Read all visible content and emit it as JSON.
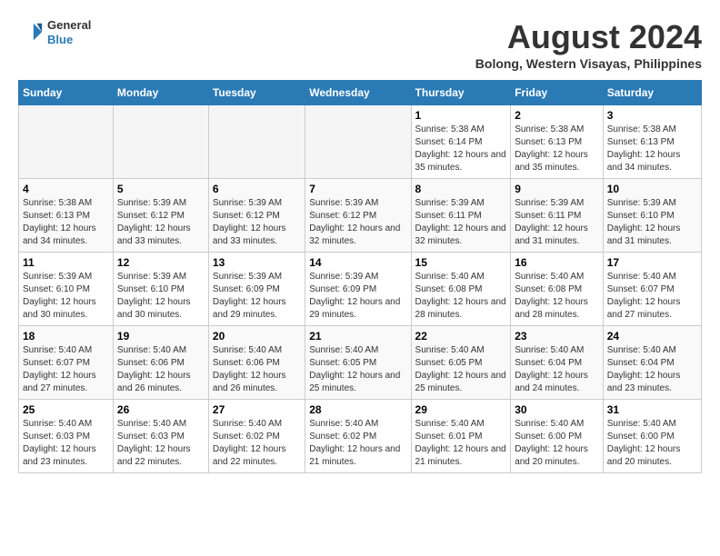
{
  "header": {
    "logo_line1": "General",
    "logo_line2": "Blue",
    "month": "August 2024",
    "location": "Bolong, Western Visayas, Philippines"
  },
  "weekdays": [
    "Sunday",
    "Monday",
    "Tuesday",
    "Wednesday",
    "Thursday",
    "Friday",
    "Saturday"
  ],
  "weeks": [
    [
      {
        "day": "",
        "empty": true
      },
      {
        "day": "",
        "empty": true
      },
      {
        "day": "",
        "empty": true
      },
      {
        "day": "",
        "empty": true
      },
      {
        "day": "1",
        "sunrise": "5:38 AM",
        "sunset": "6:14 PM",
        "daylight": "12 hours and 35 minutes."
      },
      {
        "day": "2",
        "sunrise": "5:38 AM",
        "sunset": "6:13 PM",
        "daylight": "12 hours and 35 minutes."
      },
      {
        "day": "3",
        "sunrise": "5:38 AM",
        "sunset": "6:13 PM",
        "daylight": "12 hours and 34 minutes."
      }
    ],
    [
      {
        "day": "4",
        "sunrise": "5:38 AM",
        "sunset": "6:13 PM",
        "daylight": "12 hours and 34 minutes."
      },
      {
        "day": "5",
        "sunrise": "5:39 AM",
        "sunset": "6:12 PM",
        "daylight": "12 hours and 33 minutes."
      },
      {
        "day": "6",
        "sunrise": "5:39 AM",
        "sunset": "6:12 PM",
        "daylight": "12 hours and 33 minutes."
      },
      {
        "day": "7",
        "sunrise": "5:39 AM",
        "sunset": "6:12 PM",
        "daylight": "12 hours and 32 minutes."
      },
      {
        "day": "8",
        "sunrise": "5:39 AM",
        "sunset": "6:11 PM",
        "daylight": "12 hours and 32 minutes."
      },
      {
        "day": "9",
        "sunrise": "5:39 AM",
        "sunset": "6:11 PM",
        "daylight": "12 hours and 31 minutes."
      },
      {
        "day": "10",
        "sunrise": "5:39 AM",
        "sunset": "6:10 PM",
        "daylight": "12 hours and 31 minutes."
      }
    ],
    [
      {
        "day": "11",
        "sunrise": "5:39 AM",
        "sunset": "6:10 PM",
        "daylight": "12 hours and 30 minutes."
      },
      {
        "day": "12",
        "sunrise": "5:39 AM",
        "sunset": "6:10 PM",
        "daylight": "12 hours and 30 minutes."
      },
      {
        "day": "13",
        "sunrise": "5:39 AM",
        "sunset": "6:09 PM",
        "daylight": "12 hours and 29 minutes."
      },
      {
        "day": "14",
        "sunrise": "5:39 AM",
        "sunset": "6:09 PM",
        "daylight": "12 hours and 29 minutes."
      },
      {
        "day": "15",
        "sunrise": "5:40 AM",
        "sunset": "6:08 PM",
        "daylight": "12 hours and 28 minutes."
      },
      {
        "day": "16",
        "sunrise": "5:40 AM",
        "sunset": "6:08 PM",
        "daylight": "12 hours and 28 minutes."
      },
      {
        "day": "17",
        "sunrise": "5:40 AM",
        "sunset": "6:07 PM",
        "daylight": "12 hours and 27 minutes."
      }
    ],
    [
      {
        "day": "18",
        "sunrise": "5:40 AM",
        "sunset": "6:07 PM",
        "daylight": "12 hours and 27 minutes."
      },
      {
        "day": "19",
        "sunrise": "5:40 AM",
        "sunset": "6:06 PM",
        "daylight": "12 hours and 26 minutes."
      },
      {
        "day": "20",
        "sunrise": "5:40 AM",
        "sunset": "6:06 PM",
        "daylight": "12 hours and 26 minutes."
      },
      {
        "day": "21",
        "sunrise": "5:40 AM",
        "sunset": "6:05 PM",
        "daylight": "12 hours and 25 minutes."
      },
      {
        "day": "22",
        "sunrise": "5:40 AM",
        "sunset": "6:05 PM",
        "daylight": "12 hours and 25 minutes."
      },
      {
        "day": "23",
        "sunrise": "5:40 AM",
        "sunset": "6:04 PM",
        "daylight": "12 hours and 24 minutes."
      },
      {
        "day": "24",
        "sunrise": "5:40 AM",
        "sunset": "6:04 PM",
        "daylight": "12 hours and 23 minutes."
      }
    ],
    [
      {
        "day": "25",
        "sunrise": "5:40 AM",
        "sunset": "6:03 PM",
        "daylight": "12 hours and 23 minutes."
      },
      {
        "day": "26",
        "sunrise": "5:40 AM",
        "sunset": "6:03 PM",
        "daylight": "12 hours and 22 minutes."
      },
      {
        "day": "27",
        "sunrise": "5:40 AM",
        "sunset": "6:02 PM",
        "daylight": "12 hours and 22 minutes."
      },
      {
        "day": "28",
        "sunrise": "5:40 AM",
        "sunset": "6:02 PM",
        "daylight": "12 hours and 21 minutes."
      },
      {
        "day": "29",
        "sunrise": "5:40 AM",
        "sunset": "6:01 PM",
        "daylight": "12 hours and 21 minutes."
      },
      {
        "day": "30",
        "sunrise": "5:40 AM",
        "sunset": "6:00 PM",
        "daylight": "12 hours and 20 minutes."
      },
      {
        "day": "31",
        "sunrise": "5:40 AM",
        "sunset": "6:00 PM",
        "daylight": "12 hours and 20 minutes."
      }
    ]
  ]
}
